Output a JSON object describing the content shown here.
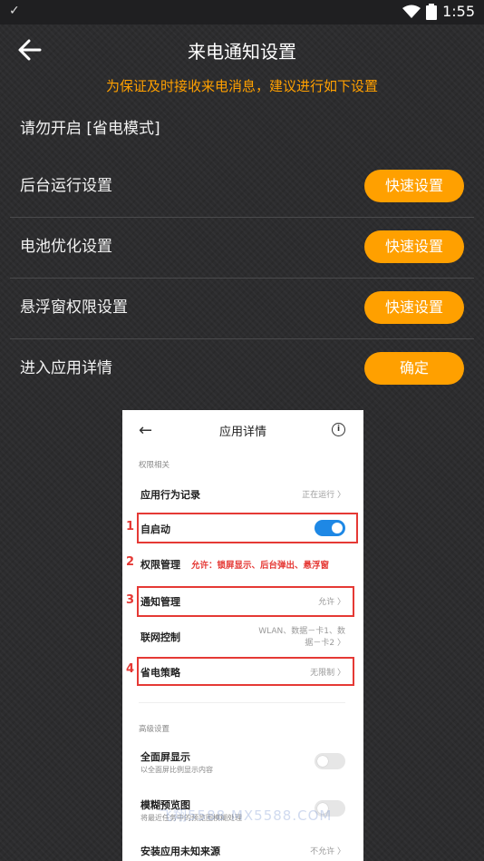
{
  "status_bar": {
    "time": "1:55",
    "left_icon": "check-icon",
    "wifi_icon": "wifi-icon",
    "battery_icon": "battery-icon"
  },
  "header": {
    "title": "来电通知设置",
    "back_icon": "arrow-left-icon"
  },
  "subtitle": "为保证及时接收来电消息，建议进行如下设置",
  "warning": "请勿开启 [省电模式]",
  "rows": [
    {
      "label": "后台运行设置",
      "button": "快速设置"
    },
    {
      "label": "电池优化设置",
      "button": "快速设置"
    },
    {
      "label": "悬浮窗权限设置",
      "button": "快速设置"
    },
    {
      "label": "进入应用详情",
      "button": "确定"
    }
  ],
  "colors": {
    "accent": "#ffa000",
    "background": "#2c2c2e",
    "annotation_red": "#e53935",
    "toggle_blue": "#1e88e5"
  },
  "guide": {
    "title": "应用详情",
    "back": "←",
    "info": "i",
    "section_permissions": "权限相关",
    "items": [
      {
        "label": "应用行为记录",
        "value": "正在运行 〉"
      },
      {
        "label": "自启动",
        "toggle": true
      },
      {
        "label": "权限管理"
      },
      {
        "label": "通知管理",
        "value": "允许 〉"
      },
      {
        "label": "联网控制",
        "value": "WLAN、数据－卡1、数",
        "value2": "据－卡2 〉"
      },
      {
        "label": "省电策略",
        "value": "无限制 〉"
      }
    ],
    "section_advanced": "高级设置",
    "advanced_items": [
      {
        "label": "全面屏显示",
        "sub": "以全面屏比例显示内容",
        "toggle": false
      },
      {
        "label": "模糊预览图",
        "sub": "将最近任务中的预览图模糊处理",
        "toggle": false
      },
      {
        "label": "安装应用未知来源",
        "value": "不允许 〉"
      }
    ],
    "annotations": {
      "n1": "1",
      "n2": "2",
      "n3": "3",
      "n4": "4",
      "note": "允许：锁屏显示、后台弹出、悬浮窗"
    },
    "watermark": "飞翔5588 MX5588.COM"
  }
}
